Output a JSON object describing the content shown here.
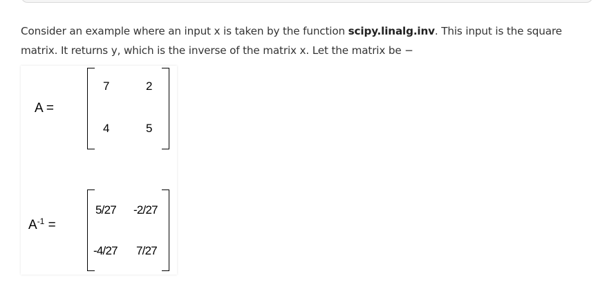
{
  "paragraph": {
    "text_before": "Consider an example where an input x is taken by the function ",
    "function_name": "scipy.linalg.inv",
    "text_after": ". This input is the square matrix. It returns y, which is the inverse of the matrix x. Let the matrix be −"
  },
  "matrix_a": {
    "label": "A =",
    "cells": [
      "7",
      "2",
      "4",
      "5"
    ]
  },
  "matrix_inverse": {
    "label_base": "A",
    "label_exponent": "-1",
    "label_equals": "=",
    "cells": [
      "5/27",
      "-2/27",
      "-4/27",
      "7/27"
    ]
  }
}
